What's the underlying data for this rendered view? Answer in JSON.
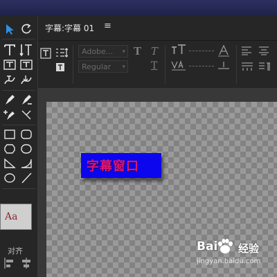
{
  "panel": {
    "title": "字幕:字幕 01",
    "menu_icon": "hamburger-menu-icon"
  },
  "toolbar": {
    "font_family": "Adobe...",
    "font_style": "Regular"
  },
  "tools": {
    "style_sample": "Aa",
    "align_label": "对齐"
  },
  "canvas": {
    "subtitle_text": "字幕窗口",
    "box_color": "#0c06ee",
    "text_color": "#e0156a"
  },
  "watermark": {
    "logo_text": "Bai",
    "brand_text": "经验",
    "url": "jingyan.baidu.com"
  }
}
